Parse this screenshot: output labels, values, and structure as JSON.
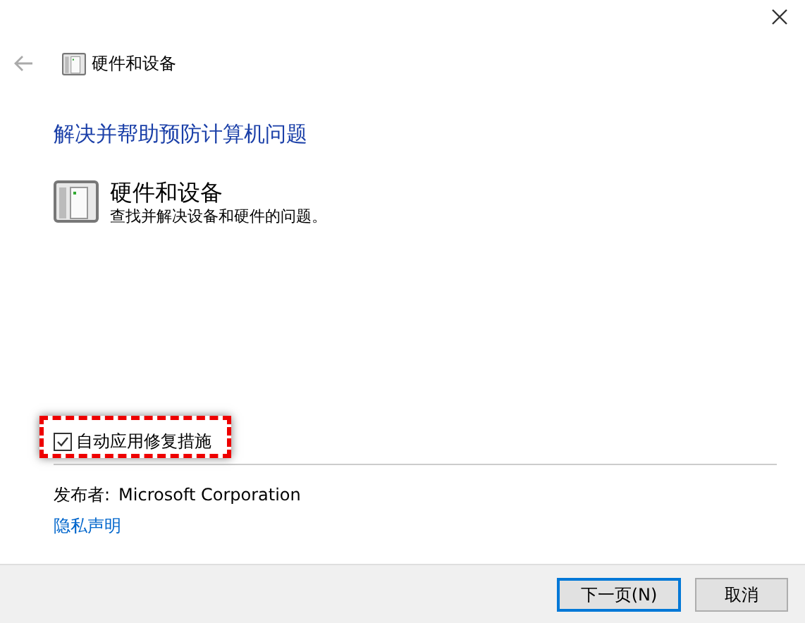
{
  "window": {
    "title": "硬件和设备"
  },
  "heading": "解决并帮助预防计算机问题",
  "troubleshooter": {
    "name": "硬件和设备",
    "description": "查找并解决设备和硬件的问题。"
  },
  "auto_repair": {
    "label": "自动应用修复措施",
    "checked": true,
    "highlighted": true
  },
  "publisher": {
    "label": "发布者:",
    "value": "Microsoft Corporation"
  },
  "privacy_link": "隐私声明",
  "buttons": [
    {
      "label": "下一页(N)",
      "default": true
    },
    {
      "label": "取消",
      "default": false
    }
  ]
}
